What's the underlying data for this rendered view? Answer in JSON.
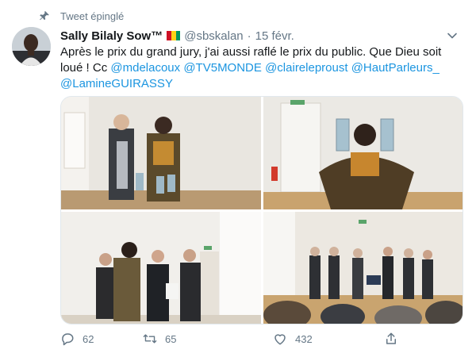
{
  "pinned": {
    "label": "Tweet épinglé"
  },
  "author": {
    "name": "Sally Bilaly Sow™",
    "handle": "@sbskalan",
    "flag": [
      "#ce1126",
      "#fcd116",
      "#009460"
    ]
  },
  "tweet": {
    "date": "15 févr.",
    "text_parts": [
      {
        "text": "Après le prix du grand jury, j'ai aussi raflé le prix du public. Que Dieu soit loué ! Cc ",
        "type": "plain"
      },
      {
        "text": "@mdelacoux",
        "type": "mention"
      },
      {
        "text": " ",
        "type": "plain"
      },
      {
        "text": "@TV5MONDE",
        "type": "mention"
      },
      {
        "text": " ",
        "type": "plain"
      },
      {
        "text": "@claireleproust",
        "type": "mention"
      },
      {
        "text": " ",
        "type": "plain"
      },
      {
        "text": "@HautParleurs_",
        "type": "mention"
      },
      {
        "text": " ",
        "type": "plain"
      },
      {
        "text": "@LamineGUIRASSY",
        "type": "mention"
      }
    ]
  },
  "actions": {
    "reply_count": "62",
    "retweet_count": "65",
    "like_count": "432"
  },
  "colors": {
    "mention": "#1b95e0",
    "secondary_text": "#657786",
    "primary_text": "#14171a"
  },
  "icons": [
    "pin-icon",
    "chevron-down-icon",
    "reply-icon",
    "retweet-icon",
    "like-icon",
    "share-icon"
  ]
}
